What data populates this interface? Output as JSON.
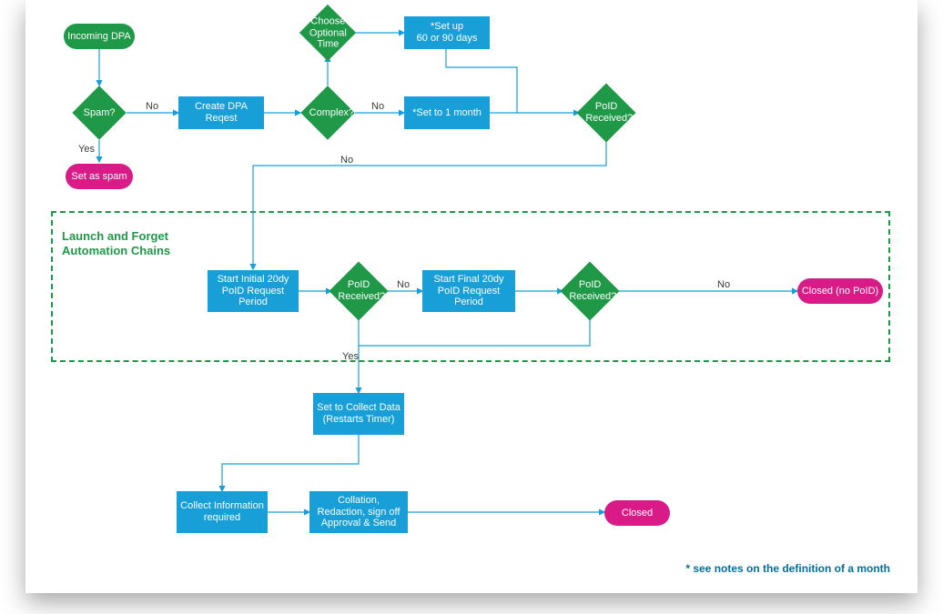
{
  "nodes": {
    "incoming_dpa": "Incoming DPA",
    "spam_q": "Spam?",
    "set_as_spam": "Set as spam",
    "create_dpa": "Create DPA Reqest",
    "complex_q": "Complex?",
    "choose_optional_time": "Choose Optional Time",
    "set_up_days": "*Set up\n60 or 90 days",
    "set_to_1mo": "*Set to 1 month",
    "poid_received_1": "PoID Received?",
    "start_initial": "Start Initial 20dy PoID Request Period",
    "poid_received_2": "PoID Received?",
    "start_final": "Start Final 20dy PoID Request Period",
    "poid_received_3": "PoID Received?",
    "closed_no_poid": "Closed (no PoID)",
    "set_to_collect": "Set to Collect Data (Restarts Timer)",
    "collect_info": "Collect Information required",
    "collation": "Collation, Redaction, sign off Approval & Send",
    "closed": "Closed"
  },
  "edge_labels": {
    "spam_no": "No",
    "spam_yes": "Yes",
    "complex_no": "No",
    "poid1_no": "No",
    "poid2_no": "No",
    "poid2_yes": "Yes",
    "poid3_no": "No"
  },
  "section_title": "Launch and Forget\nAutomation Chains",
  "footnote": "* see notes on the definition of a month"
}
